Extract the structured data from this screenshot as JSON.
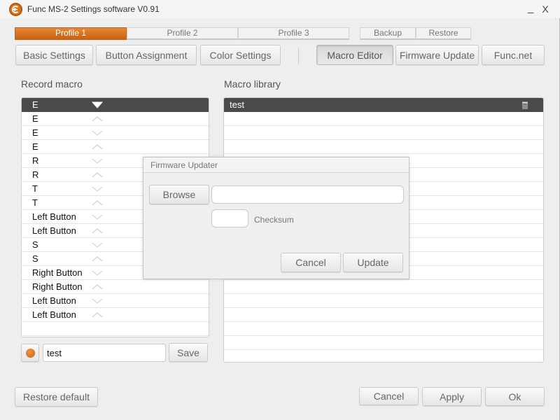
{
  "window": {
    "title": "Func MS-2 Settings software V0.91",
    "minimize": "_",
    "close": "X",
    "accent_color": "#d9731f"
  },
  "profile_tabs": [
    {
      "label": "Profile 1",
      "active": true
    },
    {
      "label": "Profile 2",
      "active": false
    },
    {
      "label": "Profile 3",
      "active": false
    }
  ],
  "profile_actions": {
    "backup": "Backup",
    "restore": "Restore"
  },
  "nav": {
    "basic_settings": "Basic Settings",
    "button_assignment": "Button Assignment",
    "color_settings": "Color Settings",
    "macro_editor": "Macro Editor",
    "firmware_update": "Firmware Update",
    "func_net": "Func.net",
    "active": "Macro Editor"
  },
  "record_macro": {
    "label": "Record macro",
    "events": [
      {
        "key": "E",
        "direction": "down",
        "selected": true
      },
      {
        "key": "E",
        "direction": "up"
      },
      {
        "key": "E",
        "direction": "down"
      },
      {
        "key": "E",
        "direction": "up"
      },
      {
        "key": "R",
        "direction": "down"
      },
      {
        "key": "R",
        "direction": "up"
      },
      {
        "key": "T",
        "direction": "down"
      },
      {
        "key": "T",
        "direction": "up"
      },
      {
        "key": "Left Button",
        "direction": "down"
      },
      {
        "key": "Left Button",
        "direction": "up"
      },
      {
        "key": "S",
        "direction": "down"
      },
      {
        "key": "S",
        "direction": "up"
      },
      {
        "key": "Right Button",
        "direction": "down"
      },
      {
        "key": "Right Button",
        "direction": "up"
      },
      {
        "key": "Left Button",
        "direction": "down"
      },
      {
        "key": "Left Button",
        "direction": "up"
      }
    ],
    "name_value": "test",
    "save_label": "Save"
  },
  "macro_library": {
    "label": "Macro library",
    "items": [
      {
        "name": "test",
        "selected": true
      }
    ]
  },
  "dialog": {
    "title": "Firmware Updater",
    "browse_label": "Browse",
    "path_value": "",
    "checksum_value": "",
    "checksum_label": "Checksum",
    "cancel_label": "Cancel",
    "update_label": "Update"
  },
  "footer": {
    "restore_default": "Restore default",
    "cancel": "Cancel",
    "apply": "Apply",
    "ok": "Ok"
  }
}
